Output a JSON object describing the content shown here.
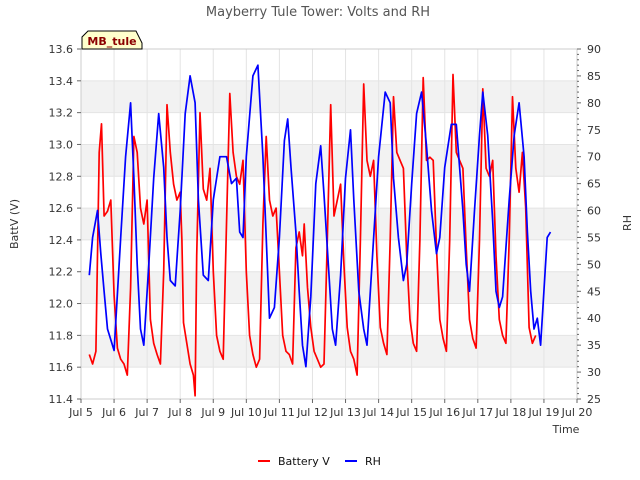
{
  "chart_data": {
    "type": "line",
    "title": "Mayberry Tule Tower: Volts and RH",
    "xlabel": "Time",
    "ylabel": "BattV (V)",
    "y2label": "RH",
    "badge": "MB_tule",
    "xlim": [
      5,
      20
    ],
    "ylim": [
      11.4,
      13.6
    ],
    "y2lim": [
      25,
      90
    ],
    "x_ticks": [
      5,
      6,
      7,
      8,
      9,
      10,
      11,
      12,
      13,
      14,
      15,
      16,
      17,
      18,
      19,
      20
    ],
    "x_tick_labels": [
      "Jul 5",
      "Jul 6",
      "Jul 7",
      "Jul 8",
      "Jul 9",
      "Jul 10",
      "Jul 11",
      "Jul 12",
      "Jul 13",
      "Jul 14",
      "Jul 15",
      "Jul 16",
      "Jul 17",
      "Jul 18",
      "Jul 19",
      "Jul 20"
    ],
    "y_ticks": [
      "11.4",
      "11.6",
      "11.8",
      "12.0",
      "12.2",
      "12.4",
      "12.6",
      "12.8",
      "13.0",
      "13.2",
      "13.4",
      "13.6"
    ],
    "y2_ticks": [
      "25",
      "30",
      "35",
      "40",
      "45",
      "50",
      "55",
      "60",
      "65",
      "70",
      "75",
      "80",
      "85",
      "90"
    ],
    "grid": true,
    "legend_position": "bottom",
    "series": [
      {
        "name": "Battery V",
        "color": "#ff0000",
        "axis": "left",
        "points": [
          [
            5.25,
            11.68
          ],
          [
            5.35,
            11.62
          ],
          [
            5.45,
            11.7
          ],
          [
            5.55,
            12.95
          ],
          [
            5.62,
            13.13
          ],
          [
            5.7,
            12.55
          ],
          [
            5.8,
            12.58
          ],
          [
            5.9,
            12.65
          ],
          [
            6.0,
            12.05
          ],
          [
            6.1,
            11.72
          ],
          [
            6.2,
            11.65
          ],
          [
            6.3,
            11.62
          ],
          [
            6.4,
            11.55
          ],
          [
            6.5,
            12.1
          ],
          [
            6.6,
            13.05
          ],
          [
            6.7,
            12.95
          ],
          [
            6.8,
            12.6
          ],
          [
            6.9,
            12.5
          ],
          [
            7.0,
            12.65
          ],
          [
            7.1,
            11.9
          ],
          [
            7.2,
            11.75
          ],
          [
            7.3,
            11.68
          ],
          [
            7.4,
            11.62
          ],
          [
            7.5,
            12.2
          ],
          [
            7.6,
            13.25
          ],
          [
            7.7,
            12.95
          ],
          [
            7.8,
            12.75
          ],
          [
            7.9,
            12.65
          ],
          [
            8.0,
            12.7
          ],
          [
            8.05,
            12.4
          ],
          [
            8.1,
            11.88
          ],
          [
            8.2,
            11.75
          ],
          [
            8.3,
            11.62
          ],
          [
            8.4,
            11.55
          ],
          [
            8.45,
            11.42
          ],
          [
            8.5,
            12.3
          ],
          [
            8.6,
            13.2
          ],
          [
            8.7,
            12.72
          ],
          [
            8.8,
            12.65
          ],
          [
            8.9,
            12.85
          ],
          [
            9.0,
            12.2
          ],
          [
            9.1,
            11.8
          ],
          [
            9.2,
            11.7
          ],
          [
            9.3,
            11.65
          ],
          [
            9.4,
            12.5
          ],
          [
            9.5,
            13.32
          ],
          [
            9.6,
            12.95
          ],
          [
            9.7,
            12.8
          ],
          [
            9.8,
            12.75
          ],
          [
            9.9,
            12.9
          ],
          [
            10.0,
            12.2
          ],
          [
            10.1,
            11.8
          ],
          [
            10.2,
            11.68
          ],
          [
            10.3,
            11.6
          ],
          [
            10.4,
            11.65
          ],
          [
            10.5,
            12.5
          ],
          [
            10.6,
            13.05
          ],
          [
            10.7,
            12.65
          ],
          [
            10.8,
            12.55
          ],
          [
            10.9,
            12.6
          ],
          [
            11.0,
            12.2
          ],
          [
            11.1,
            11.8
          ],
          [
            11.2,
            11.7
          ],
          [
            11.3,
            11.68
          ],
          [
            11.4,
            11.62
          ],
          [
            11.5,
            12.35
          ],
          [
            11.6,
            12.45
          ],
          [
            11.7,
            12.3
          ],
          [
            11.75,
            12.5
          ],
          [
            11.85,
            12.1
          ],
          [
            11.95,
            11.85
          ],
          [
            12.05,
            11.7
          ],
          [
            12.15,
            11.65
          ],
          [
            12.25,
            11.6
          ],
          [
            12.35,
            11.62
          ],
          [
            12.45,
            12.4
          ],
          [
            12.55,
            13.25
          ],
          [
            12.65,
            12.55
          ],
          [
            12.75,
            12.65
          ],
          [
            12.85,
            12.75
          ],
          [
            12.95,
            12.25
          ],
          [
            13.05,
            11.85
          ],
          [
            13.15,
            11.7
          ],
          [
            13.25,
            11.65
          ],
          [
            13.35,
            11.55
          ],
          [
            13.45,
            12.4
          ],
          [
            13.55,
            13.38
          ],
          [
            13.65,
            12.9
          ],
          [
            13.75,
            12.8
          ],
          [
            13.85,
            12.9
          ],
          [
            13.95,
            12.3
          ],
          [
            14.05,
            11.85
          ],
          [
            14.15,
            11.75
          ],
          [
            14.25,
            11.68
          ],
          [
            14.35,
            12.4
          ],
          [
            14.45,
            13.3
          ],
          [
            14.55,
            12.95
          ],
          [
            14.65,
            12.9
          ],
          [
            14.75,
            12.85
          ],
          [
            14.85,
            12.3
          ],
          [
            14.95,
            11.9
          ],
          [
            15.05,
            11.75
          ],
          [
            15.15,
            11.7
          ],
          [
            15.25,
            12.4
          ],
          [
            15.35,
            13.42
          ],
          [
            15.45,
            12.9
          ],
          [
            15.55,
            12.92
          ],
          [
            15.65,
            12.9
          ],
          [
            15.75,
            12.35
          ],
          [
            15.85,
            11.9
          ],
          [
            15.95,
            11.78
          ],
          [
            16.05,
            11.7
          ],
          [
            16.15,
            12.4
          ],
          [
            16.25,
            13.44
          ],
          [
            16.35,
            12.95
          ],
          [
            16.45,
            12.9
          ],
          [
            16.55,
            12.85
          ],
          [
            16.65,
            12.35
          ],
          [
            16.75,
            11.9
          ],
          [
            16.85,
            11.78
          ],
          [
            16.95,
            11.72
          ],
          [
            17.05,
            12.4
          ],
          [
            17.15,
            13.35
          ],
          [
            17.25,
            12.85
          ],
          [
            17.35,
            12.8
          ],
          [
            17.45,
            12.9
          ],
          [
            17.55,
            12.3
          ],
          [
            17.65,
            11.9
          ],
          [
            17.75,
            11.8
          ],
          [
            17.85,
            11.75
          ],
          [
            17.95,
            12.4
          ],
          [
            18.05,
            13.3
          ],
          [
            18.15,
            12.85
          ],
          [
            18.25,
            12.7
          ],
          [
            18.35,
            12.95
          ],
          [
            18.45,
            12.6
          ],
          [
            18.55,
            11.85
          ],
          [
            18.65,
            11.75
          ],
          [
            18.75,
            11.8
          ]
        ]
      },
      {
        "name": "RH",
        "color": "#0000ff",
        "axis": "right",
        "points": [
          [
            5.25,
            48
          ],
          [
            5.35,
            55
          ],
          [
            5.5,
            60
          ],
          [
            5.6,
            52
          ],
          [
            5.7,
            45
          ],
          [
            5.8,
            38
          ],
          [
            5.9,
            36
          ],
          [
            6.0,
            34
          ],
          [
            6.2,
            55
          ],
          [
            6.35,
            70
          ],
          [
            6.5,
            80
          ],
          [
            6.6,
            66
          ],
          [
            6.7,
            50
          ],
          [
            6.8,
            38
          ],
          [
            6.9,
            35
          ],
          [
            7.05,
            50
          ],
          [
            7.2,
            66
          ],
          [
            7.35,
            78
          ],
          [
            7.5,
            68
          ],
          [
            7.6,
            55
          ],
          [
            7.7,
            47
          ],
          [
            7.85,
            46
          ],
          [
            8.0,
            60
          ],
          [
            8.15,
            78
          ],
          [
            8.3,
            85
          ],
          [
            8.45,
            80
          ],
          [
            8.55,
            62
          ],
          [
            8.7,
            48
          ],
          [
            8.85,
            47
          ],
          [
            9.0,
            62
          ],
          [
            9.2,
            70
          ],
          [
            9.4,
            70
          ],
          [
            9.55,
            65
          ],
          [
            9.7,
            66
          ],
          [
            9.8,
            56
          ],
          [
            9.9,
            55
          ],
          [
            10.0,
            70
          ],
          [
            10.2,
            85
          ],
          [
            10.35,
            87
          ],
          [
            10.5,
            70
          ],
          [
            10.6,
            55
          ],
          [
            10.7,
            40
          ],
          [
            10.85,
            42
          ],
          [
            11.0,
            55
          ],
          [
            11.15,
            73
          ],
          [
            11.25,
            77
          ],
          [
            11.35,
            68
          ],
          [
            11.5,
            56
          ],
          [
            11.6,
            45
          ],
          [
            11.7,
            35
          ],
          [
            11.8,
            31
          ],
          [
            11.95,
            44
          ],
          [
            12.1,
            65
          ],
          [
            12.25,
            72
          ],
          [
            12.35,
            63
          ],
          [
            12.5,
            48
          ],
          [
            12.6,
            38
          ],
          [
            12.7,
            35
          ],
          [
            12.85,
            48
          ],
          [
            13.0,
            66
          ],
          [
            13.15,
            75
          ],
          [
            13.25,
            62
          ],
          [
            13.4,
            45
          ],
          [
            13.55,
            38
          ],
          [
            13.65,
            35
          ],
          [
            13.8,
            50
          ],
          [
            14.0,
            70
          ],
          [
            14.2,
            82
          ],
          [
            14.35,
            80
          ],
          [
            14.45,
            66
          ],
          [
            14.6,
            55
          ],
          [
            14.75,
            47
          ],
          [
            14.85,
            50
          ],
          [
            15.0,
            65
          ],
          [
            15.15,
            78
          ],
          [
            15.3,
            82
          ],
          [
            15.45,
            72
          ],
          [
            15.6,
            60
          ],
          [
            15.75,
            52
          ],
          [
            15.85,
            55
          ],
          [
            16.0,
            68
          ],
          [
            16.2,
            76
          ],
          [
            16.35,
            76
          ],
          [
            16.45,
            68
          ],
          [
            16.55,
            60
          ],
          [
            16.65,
            50
          ],
          [
            16.75,
            45
          ],
          [
            16.9,
            60
          ],
          [
            17.05,
            74
          ],
          [
            17.15,
            82
          ],
          [
            17.3,
            74
          ],
          [
            17.45,
            58
          ],
          [
            17.55,
            45
          ],
          [
            17.65,
            42
          ],
          [
            17.75,
            44
          ],
          [
            17.95,
            62
          ],
          [
            18.1,
            74
          ],
          [
            18.25,
            80
          ],
          [
            18.4,
            70
          ],
          [
            18.5,
            56
          ],
          [
            18.6,
            45
          ],
          [
            18.7,
            38
          ],
          [
            18.8,
            40
          ],
          [
            18.9,
            35
          ],
          [
            19.0,
            45
          ],
          [
            19.1,
            55
          ],
          [
            19.2,
            56
          ]
        ]
      }
    ]
  }
}
